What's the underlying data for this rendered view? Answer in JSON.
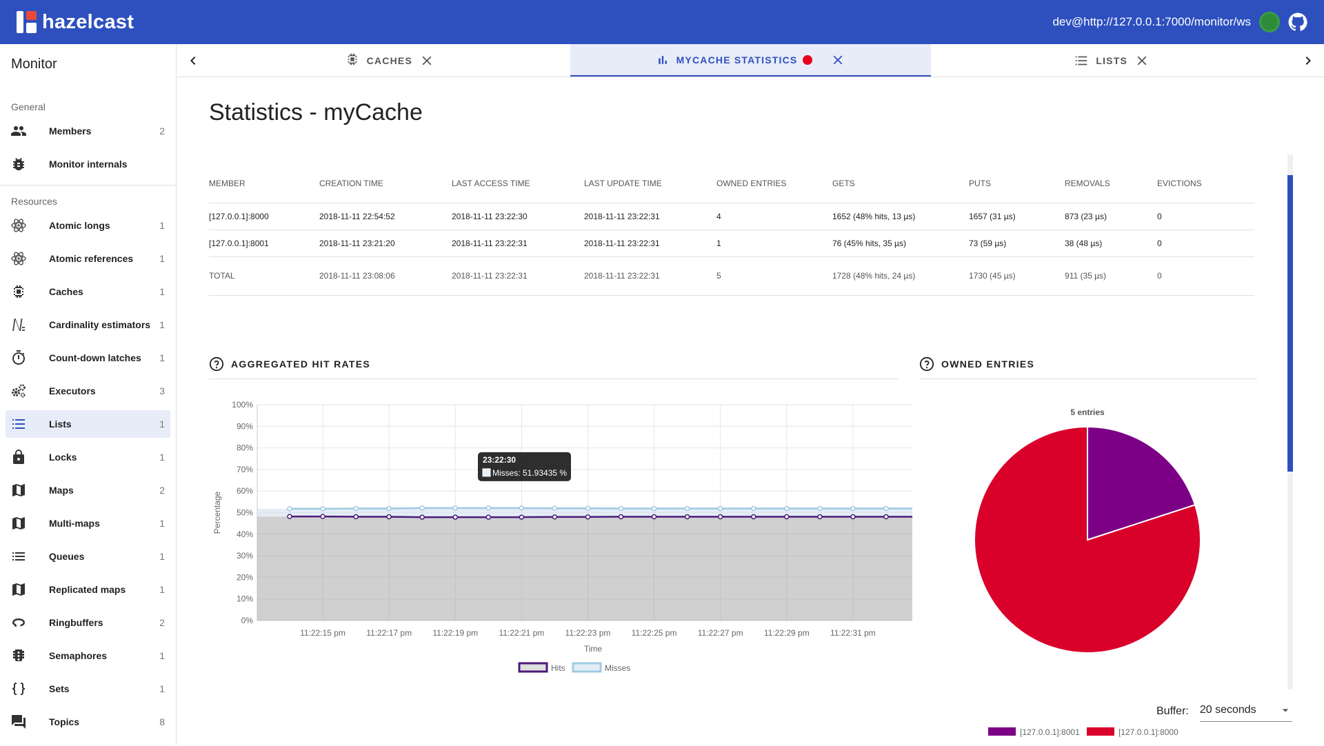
{
  "header": {
    "logo_text": "hazelcast",
    "connection": "dev@http://127.0.0.1:7000/monitor/ws",
    "status_color": "#2e8b3a",
    "brand_color": "#2e50be"
  },
  "sidebar": {
    "title": "Monitor",
    "general_label": "General",
    "general_items": [
      {
        "label": "Members",
        "count": "2",
        "icon": "people-icon"
      },
      {
        "label": "Monitor internals",
        "count": "",
        "icon": "bug-icon"
      }
    ],
    "resources_label": "Resources",
    "resource_items": [
      {
        "label": "Atomic longs",
        "count": "1",
        "icon": "atom-icon"
      },
      {
        "label": "Atomic references",
        "count": "1",
        "icon": "atom-icon"
      },
      {
        "label": "Caches",
        "count": "1",
        "icon": "chip-icon"
      },
      {
        "label": "Cardinality estimators",
        "count": "1",
        "icon": "sigma-icon"
      },
      {
        "label": "Count-down latches",
        "count": "1",
        "icon": "timer-icon"
      },
      {
        "label": "Executors",
        "count": "3",
        "icon": "gears-icon"
      },
      {
        "label": "Lists",
        "count": "1",
        "icon": "list-icon"
      },
      {
        "label": "Locks",
        "count": "1",
        "icon": "lock-icon"
      },
      {
        "label": "Maps",
        "count": "2",
        "icon": "map-icon"
      },
      {
        "label": "Multi-maps",
        "count": "1",
        "icon": "map-icon"
      },
      {
        "label": "Queues",
        "count": "1",
        "icon": "queue-icon"
      },
      {
        "label": "Replicated maps",
        "count": "1",
        "icon": "map-icon"
      },
      {
        "label": "Ringbuffers",
        "count": "2",
        "icon": "ring-icon"
      },
      {
        "label": "Semaphores",
        "count": "1",
        "icon": "semaphore-icon"
      },
      {
        "label": "Sets",
        "count": "1",
        "icon": "braces-icon"
      },
      {
        "label": "Topics",
        "count": "8",
        "icon": "chat-icon"
      }
    ]
  },
  "tabs": [
    {
      "label": "CACHES",
      "icon": "chip-icon",
      "active": false
    },
    {
      "label": "MYCACHE STATISTICS",
      "icon": "bar-chart-icon",
      "active": true
    },
    {
      "label": "LISTS",
      "icon": "list-icon",
      "active": false
    }
  ],
  "page": {
    "title": "Statistics - myCache"
  },
  "table": {
    "headers": [
      "MEMBER",
      "CREATION TIME",
      "LAST ACCESS TIME",
      "LAST UPDATE TIME",
      "OWNED ENTRIES",
      "GETS",
      "PUTS",
      "REMOVALS",
      "EVICTIONS"
    ],
    "rows": [
      [
        "[127.0.0.1]:8000",
        "2018-11-11 22:54:52",
        "2018-11-11 23:22:30",
        "2018-11-11 23:22:31",
        "4",
        "1652 (48% hits, 13 µs)",
        "1657 (31 µs)",
        "873 (23 µs)",
        "0"
      ],
      [
        "[127.0.0.1]:8001",
        "2018-11-11 23:21:20",
        "2018-11-11 23:22:31",
        "2018-11-11 23:22:31",
        "1",
        "76 (45% hits, 35 µs)",
        "73 (59 µs)",
        "38 (48 µs)",
        "0"
      ]
    ],
    "total": [
      "TOTAL",
      "2018-11-11 23:08:06",
      "2018-11-11 23:22:31",
      "2018-11-11 23:22:31",
      "5",
      "1728 (48% hits, 24 µs)",
      "1730 (45 µs)",
      "911 (35 µs)",
      "0"
    ]
  },
  "hit_rates": {
    "heading": "AGGREGATED HIT RATES",
    "tooltip_title": "23:22:30",
    "tooltip_text": "Misses: 51.93435 %"
  },
  "owned_entries": {
    "heading": "OWNED ENTRIES"
  },
  "buffer": {
    "label": "Buffer:",
    "value": "20 seconds"
  },
  "chart_data": [
    {
      "type": "line",
      "title": "",
      "xlabel": "Time",
      "ylabel": "Percentage",
      "ylim": [
        0,
        100
      ],
      "y_ticks": [
        "0%",
        "10%",
        "20%",
        "30%",
        "40%",
        "50%",
        "60%",
        "70%",
        "80%",
        "90%",
        "100%"
      ],
      "x_ticks": [
        "11:22:15 pm",
        "11:22:17 pm",
        "11:22:19 pm",
        "11:22:21 pm",
        "11:22:23 pm",
        "11:22:25 pm",
        "11:22:27 pm",
        "11:22:29 pm",
        "11:22:31 pm"
      ],
      "x_count": 20,
      "legend": "bottom",
      "grid": true,
      "series": [
        {
          "name": "Hits",
          "color": "#4a1a7a",
          "values": [
            48.2,
            48.2,
            48.1,
            48.1,
            47.9,
            47.9,
            47.9,
            47.9,
            48.0,
            48.0,
            48.1,
            48.1,
            48.1,
            48.1,
            48.1,
            48.1,
            48.1,
            48.1,
            48.1,
            48.1
          ]
        },
        {
          "name": "Misses",
          "color": "#9ecae1",
          "values": [
            51.8,
            51.8,
            51.9,
            51.9,
            52.1,
            52.1,
            52.1,
            52.1,
            52.0,
            52.0,
            51.93,
            51.9,
            51.9,
            51.9,
            51.9,
            51.9,
            51.9,
            51.9,
            51.9,
            51.9
          ]
        }
      ]
    },
    {
      "type": "pie",
      "title": "5 entries",
      "legend": "bottom",
      "slices": [
        {
          "label": "[127.0.0.1]:8001",
          "value": 1,
          "color": "#7b0085"
        },
        {
          "label": "[127.0.0.1]:8000",
          "value": 4,
          "color": "#d9002a"
        }
      ]
    }
  ]
}
